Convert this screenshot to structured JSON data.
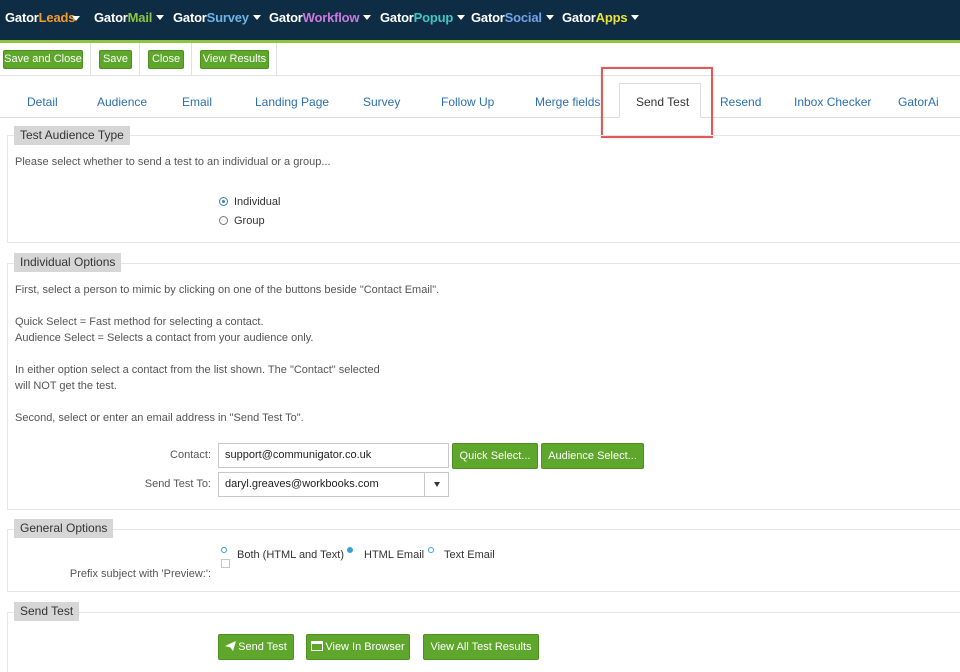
{
  "topnav": {
    "items": [
      {
        "a": "Gator",
        "b": "Leads",
        "color": "#f39c2c"
      },
      {
        "a": "Gator",
        "b": "Mail",
        "color": "#8cc63f"
      },
      {
        "a": "Gator",
        "b": "Survey",
        "color": "#6fb3e8"
      },
      {
        "a": "Gator",
        "b": "Workflow",
        "color": "#c87adf"
      },
      {
        "a": "Gator",
        "b": "Popup",
        "color": "#3fc6c6"
      },
      {
        "a": "Gator",
        "b": "Social",
        "color": "#6fa4e8"
      },
      {
        "a": "Gator",
        "b": "Apps",
        "color": "#e8e23a"
      }
    ]
  },
  "toolbar": {
    "save_close": "Save and Close",
    "save": "Save",
    "close": "Close",
    "view_results": "View Results"
  },
  "tabs": {
    "detail": "Detail",
    "audience": "Audience",
    "email": "Email",
    "landing_page": "Landing Page",
    "survey": "Survey",
    "follow_up": "Follow Up",
    "merge_fields": "Merge fields",
    "send_test": "Send Test",
    "resend": "Resend",
    "inbox_checker": "Inbox Checker",
    "gatorai": "GatorAi"
  },
  "test_audience": {
    "legend": "Test Audience Type",
    "intro": "Please select whether to send a test to an individual or a group...",
    "individual": "Individual",
    "group": "Group",
    "selected": "Individual"
  },
  "individual_options": {
    "legend": "Individual Options",
    "line1": "First, select a person to mimic by clicking on one of the buttons beside \"Contact Email\".",
    "line2": "Quick Select = Fast method for selecting a contact.",
    "line3": "Audience Select = Selects a contact from your audience only.",
    "line4": "In either option select a contact from the list shown. The \"Contact\" selected",
    "line5": "will NOT get the test.",
    "line6": "Second, select or enter an email address in \"Send Test To\".",
    "contact_label": "Contact:",
    "contact_value": "support@communigator.co.uk",
    "quick_select": "Quick Select...",
    "audience_select": "Audience Select...",
    "send_to_label": "Send Test To:",
    "send_to_value": "daryl.greaves@workbooks.com"
  },
  "general_options": {
    "legend": "General Options",
    "both": "Both (HTML and Text)",
    "html": "HTML Email",
    "text": "Text Email",
    "selected_format": "HTML Email",
    "prefix_label": "Prefix subject with 'Preview:':",
    "prefix_checked": false
  },
  "send_test": {
    "legend": "Send Test",
    "send_btn": "Send Test",
    "browser_btn": "View In Browser",
    "all_results_btn": "View All Test Results"
  }
}
